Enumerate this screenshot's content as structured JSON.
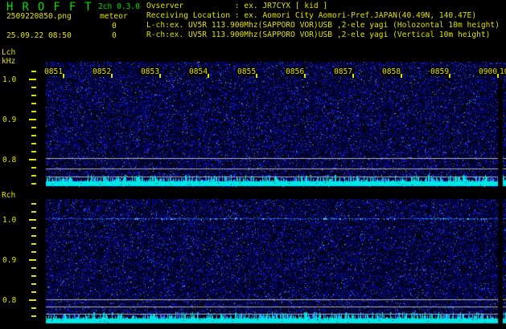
{
  "header": {
    "title": "H R O F F T",
    "version": "2ch 0.3.0",
    "filename": "2509220850.png",
    "mode": "meteor",
    "count1": "0",
    "count2": "0",
    "datetime": "25.09.22 08:50",
    "observer_line": "Ovserver           : ex. JR7CYX [ kid ]",
    "location_line": "Receiving Location : ex. Aomori City Aomori-Pref.JAPAN(40.49N, 140.47E)",
    "lch_line": "L-ch:ex. UV5R 113.900Mhz(SAPPORO VOR)USB ,2-ele yagi (Holozontal 10m height)",
    "rch_line": "R-ch:ex. UV5R 113.900Mhz(SAPPORO VOR)USB ,2-ele yagi (Vertical 10m height)"
  },
  "axis": {
    "lch_label": "Lch",
    "rch_label": "Rch",
    "freq_unit": "kHz",
    "freq_ticks": [
      "1.0",
      "0.9",
      "0.8"
    ]
  },
  "time_labels": [
    "0851",
    "0852",
    "0853",
    "0854",
    "0855",
    "0856",
    "0857",
    "0858",
    "0859",
    "0900"
  ],
  "time_label_partial": "10",
  "colors": {
    "background": "#000000",
    "text_yellow": "#e0e000",
    "text_green": "#00dd00",
    "band_cyan": "#00e6e6",
    "grid_gray": "#b4b4b4",
    "carrier_blue": "#2a50dd",
    "noise_blue": "#0000aa"
  }
}
